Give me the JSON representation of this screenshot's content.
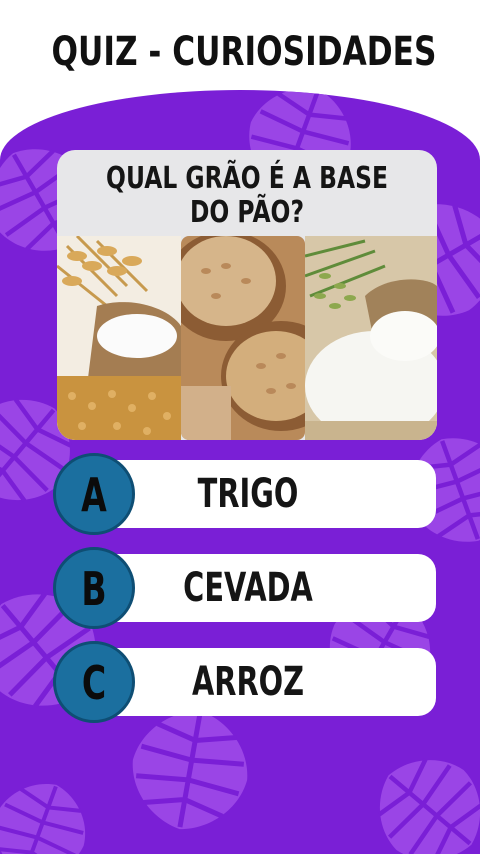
{
  "title": "QUIZ - CURIOSIDADES",
  "question": {
    "line1": "QUAL GRÃO É A BASE",
    "line2": "DO PÃO?"
  },
  "images": [
    {
      "name": "wheat-and-flour-photo"
    },
    {
      "name": "barley-grains-photo"
    },
    {
      "name": "rice-photo"
    }
  ],
  "options": [
    {
      "letter": "A",
      "label": "TRIGO"
    },
    {
      "letter": "B",
      "label": "CEVADA"
    },
    {
      "letter": "C",
      "label": "ARROZ"
    }
  ],
  "colors": {
    "background_purple": "#7a1fd6",
    "leaf_purple": "#9a45e6",
    "badge_blue": "#1b6f9f",
    "card_gray": "#e7e7e9"
  }
}
